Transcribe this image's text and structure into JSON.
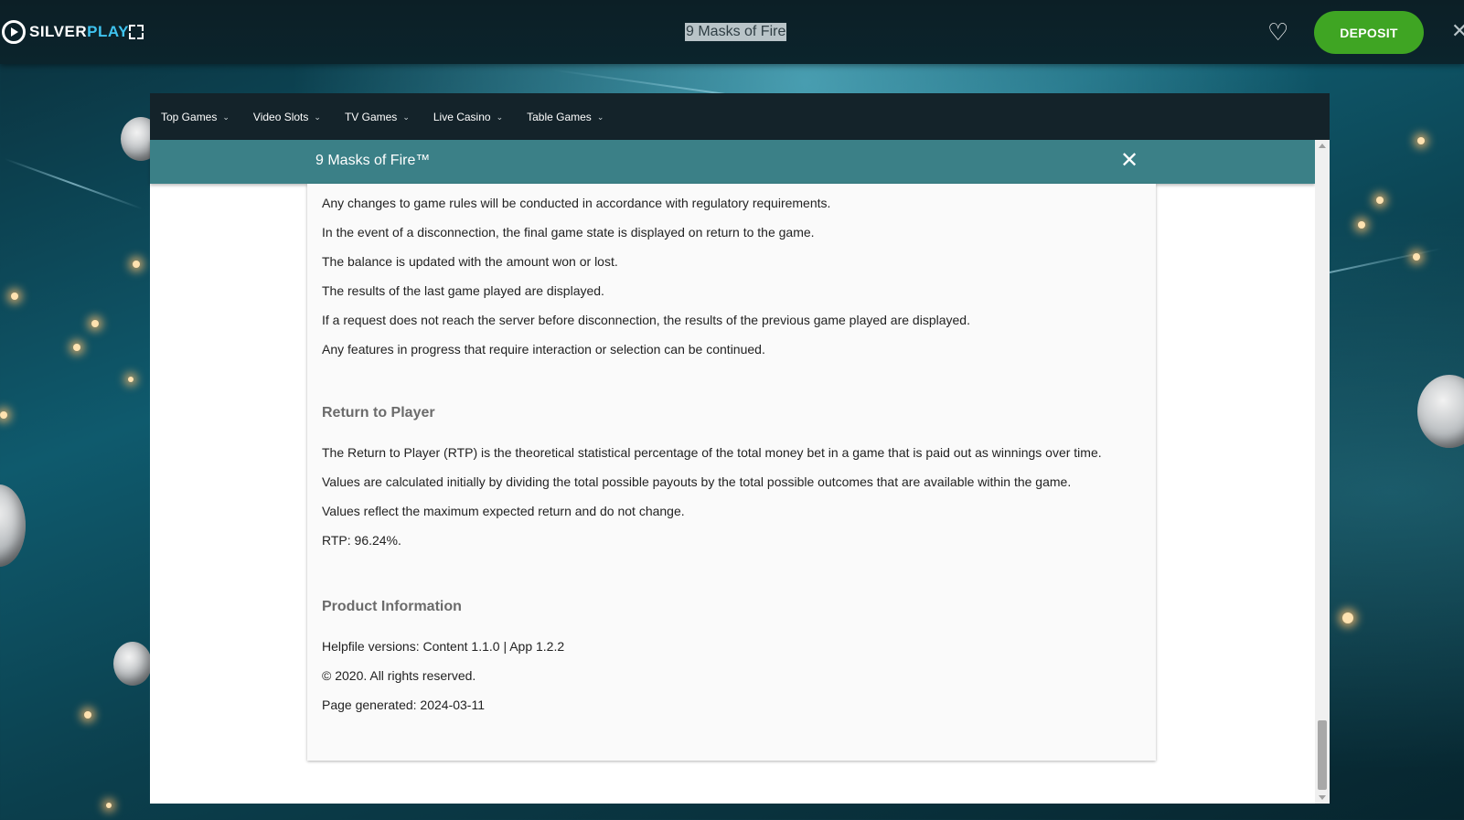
{
  "topbar": {
    "logo_text_a": "SILVER",
    "logo_text_b": "PLAY",
    "game_title": "9 Masks of Fire",
    "deposit_label": "DEPOSIT",
    "close_glyph": "✕",
    "heart_glyph": "♡"
  },
  "nav": {
    "items": [
      "Top Games",
      "Video Slots",
      "TV Games",
      "Live Casino",
      "Table Games"
    ],
    "chevron": "⌄"
  },
  "modal": {
    "title": "9 Masks of Fire™",
    "close_glyph": "✕"
  },
  "content": {
    "lines_top": [
      "Any changes to game rules will be conducted in accordance with regulatory requirements.",
      "In the event of a disconnection, the final game state is displayed on return to the game.",
      "The balance is updated with the amount won or lost.",
      "The results of the last game played are displayed.",
      "If a request does not reach the server before disconnection, the results of the previous game played are displayed.",
      "Any features in progress that require interaction or selection can be continued."
    ],
    "rtp_heading": "Return to Player",
    "rtp_lines": [
      "The Return to Player (RTP) is the theoretical statistical percentage of the total money bet in a game that is paid out as winnings over time.",
      "Values are calculated initially by dividing the total possible payouts by the total possible outcomes that are available within the game.",
      "Values reflect the maximum expected return and do not change.",
      "RTP: 96.24%."
    ],
    "product_heading": "Product Information",
    "product_lines": [
      "Helpfile versions: Content 1.1.0 | App 1.2.2",
      "© 2020. All rights reserved.",
      "Page generated: 2024-03-11"
    ]
  },
  "colors": {
    "deposit": "#3fa523",
    "modal_header": "#3b8087",
    "nav_bg": "#14232a",
    "logo_accent": "#3fc3ef"
  }
}
